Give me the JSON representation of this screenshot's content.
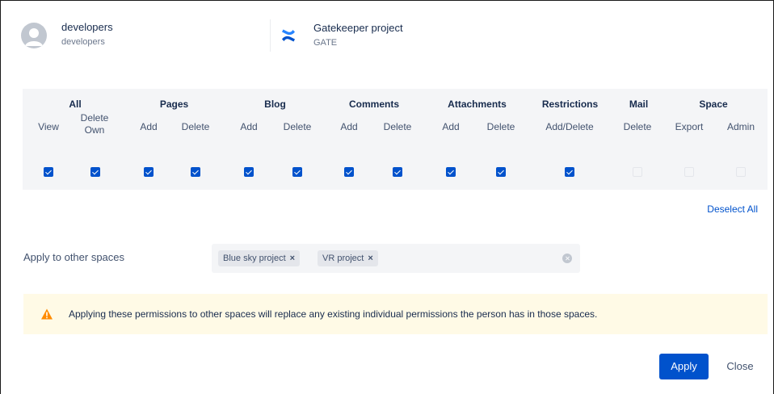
{
  "group": {
    "name": "developers",
    "subtitle": "developers",
    "icon": "user-avatar-icon"
  },
  "space": {
    "name": "Gatekeeper project",
    "key": "GATE",
    "icon": "confluence-logo-icon"
  },
  "permissions": {
    "categories": [
      {
        "label": "All"
      },
      {
        "label": "Pages"
      },
      {
        "label": "Blog"
      },
      {
        "label": "Comments"
      },
      {
        "label": "Attachments"
      },
      {
        "label": "Restrictions"
      },
      {
        "label": "Mail"
      },
      {
        "label": "Space"
      }
    ],
    "columns": [
      {
        "label": "View",
        "checked": true
      },
      {
        "label": "Delete Own",
        "checked": true
      },
      {
        "label": "Add",
        "checked": true
      },
      {
        "label": "Delete",
        "checked": true
      },
      {
        "label": "Add",
        "checked": true
      },
      {
        "label": "Delete",
        "checked": true
      },
      {
        "label": "Add",
        "checked": true
      },
      {
        "label": "Delete",
        "checked": true
      },
      {
        "label": "Add",
        "checked": true
      },
      {
        "label": "Delete",
        "checked": true
      },
      {
        "label": "Add/Delete",
        "checked": true
      },
      {
        "label": "Delete",
        "checked": false
      },
      {
        "label": "Export",
        "checked": false
      },
      {
        "label": "Admin",
        "checked": false
      }
    ],
    "checkbox_color": "#0052cc"
  },
  "deselect_all": "Deselect All",
  "apply_to_other": {
    "label": "Apply to other spaces",
    "tags": [
      "Blue sky project",
      "VR project"
    ],
    "tag_remove": "×"
  },
  "warning": {
    "text": "Applying these permissions to other spaces will replace any existing individual permissions the person has in those spaces.",
    "icon": "warning-icon",
    "color": "#ff8b00"
  },
  "buttons": {
    "apply": "Apply",
    "close": "Close"
  }
}
